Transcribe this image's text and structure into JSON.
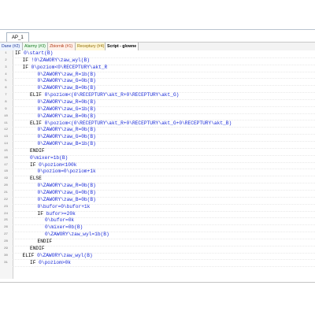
{
  "window_tab": "AP_1",
  "tabs": [
    {
      "label": "Dane (#2)",
      "color": "#1f3a9a",
      "bg": "#eef4ff"
    },
    {
      "label": "Alarmy (#3)",
      "color": "#1a7d25",
      "bg": "#edf9ee"
    },
    {
      "label": "Zbiornik (#1)",
      "color": "#b23a16",
      "bg": "#fff1ea"
    },
    {
      "label": "Receptury (#4)",
      "color": "#8f6b00",
      "bg": "#fff7d8"
    },
    {
      "label": "Script - glowne",
      "color": "#000000",
      "bg": "#ffffff"
    }
  ],
  "code_lines": [
    {
      "n": "1",
      "indent": 0,
      "kw": "IF",
      "txt": " 0\\start(B)"
    },
    {
      "n": "2",
      "indent": 1,
      "kw": "IF",
      "txt": " !0\\ZAWORY\\zaw_wyl(B)"
    },
    {
      "n": "3",
      "indent": 1,
      "kw": "IF",
      "txt": " 0\\poziom<0\\RECEPTURY\\akt_R"
    },
    {
      "n": "4",
      "indent": 3,
      "kw": "",
      "txt": "0\\ZAWORY\\zaw_R=1b(B)"
    },
    {
      "n": "5",
      "indent": 3,
      "kw": "",
      "txt": "0\\ZAWORY\\zaw_G=0b(B)"
    },
    {
      "n": "6",
      "indent": 3,
      "kw": "",
      "txt": "0\\ZAWORY\\zaw_B=0b(B)"
    },
    {
      "n": "7",
      "indent": 2,
      "kw": "ELIF",
      "txt": " 0\\poziom<(0\\RECEPTURY\\akt_R+0\\RECEPTURY\\akt_G)"
    },
    {
      "n": "8",
      "indent": 3,
      "kw": "",
      "txt": "0\\ZAWORY\\zaw_R=0b(B)"
    },
    {
      "n": "9",
      "indent": 3,
      "kw": "",
      "txt": "0\\ZAWORY\\zaw_G=1b(B)"
    },
    {
      "n": "10",
      "indent": 3,
      "kw": "",
      "txt": "0\\ZAWORY\\zaw_B=0b(B)"
    },
    {
      "n": "11",
      "indent": 2,
      "kw": "ELIF",
      "txt": " 0\\poziom<(0\\RECEPTURY\\akt_R+0\\RECEPTURY\\akt_G+0\\RECEPTURY\\akt_B)"
    },
    {
      "n": "12",
      "indent": 3,
      "kw": "",
      "txt": "0\\ZAWORY\\zaw_R=0b(B)"
    },
    {
      "n": "13",
      "indent": 3,
      "kw": "",
      "txt": "0\\ZAWORY\\zaw_G=0b(B)"
    },
    {
      "n": "14",
      "indent": 3,
      "kw": "",
      "txt": "0\\ZAWORY\\zaw_B=1b(B)"
    },
    {
      "n": "15",
      "indent": 2,
      "kw": "ENDIF",
      "txt": ""
    },
    {
      "n": "16",
      "indent": 2,
      "kw": "",
      "txt": "0\\mixer=1b(B)"
    },
    {
      "n": "17",
      "indent": 2,
      "kw": "IF",
      "txt": " 0\\poziom<100k"
    },
    {
      "n": "18",
      "indent": 3,
      "kw": "",
      "txt": "0\\poziom=0\\poziom+1k"
    },
    {
      "n": "19",
      "indent": 2,
      "kw": "ELSE",
      "txt": ""
    },
    {
      "n": "20",
      "indent": 3,
      "kw": "",
      "txt": "0\\ZAWORY\\zaw_R=0b(B)"
    },
    {
      "n": "21",
      "indent": 3,
      "kw": "",
      "txt": "0\\ZAWORY\\zaw_G=0b(B)"
    },
    {
      "n": "22",
      "indent": 3,
      "kw": "",
      "txt": "0\\ZAWORY\\zaw_B=0b(B)"
    },
    {
      "n": "23",
      "indent": 3,
      "kw": "",
      "txt": "0\\bufor=0\\bufor+1k"
    },
    {
      "n": "24",
      "indent": 3,
      "kw": "IF",
      "txt": " bufor>=20k"
    },
    {
      "n": "25",
      "indent": 4,
      "kw": "",
      "txt": "0\\bufor=0k"
    },
    {
      "n": "26",
      "indent": 4,
      "kw": "",
      "txt": "0\\mixer=0b(B)"
    },
    {
      "n": "27",
      "indent": 4,
      "kw": "",
      "txt": "0\\ZAWORY\\zaw_wyl=1b(B)"
    },
    {
      "n": "28",
      "indent": 3,
      "kw": "ENDIF",
      "txt": ""
    },
    {
      "n": "29",
      "indent": 2,
      "kw": "ENDIF",
      "txt": ""
    },
    {
      "n": "30",
      "indent": 1,
      "kw": "ELIF",
      "txt": " 0\\ZAWORY\\zaw_wyl(B)"
    },
    {
      "n": "31",
      "indent": 2,
      "kw": "IF",
      "txt": " 0\\poziom>0k"
    }
  ]
}
